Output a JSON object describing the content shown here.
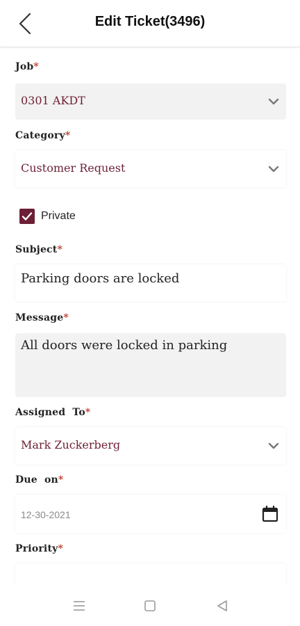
{
  "header": {
    "title": "Edit Ticket(3496)"
  },
  "form": {
    "job": {
      "label": "Job",
      "value": "0301 AKDT"
    },
    "category": {
      "label": "Category",
      "value": "Customer Request"
    },
    "private": {
      "label": "Private",
      "checked": true
    },
    "subject": {
      "label": "Subject",
      "value": "Parking doors are locked"
    },
    "message": {
      "label": "Message",
      "value": "All doors were locked in parking"
    },
    "assigned_to": {
      "label": "Assigned  To",
      "value": "Mark Zuckerberg"
    },
    "due_on": {
      "label": "Due  on",
      "value": "12-30-2021"
    },
    "priority": {
      "label": "Priority"
    },
    "required_marker": "*"
  },
  "colors": {
    "accent": "#6d1f35",
    "required": "#c0392b",
    "field_bg": "#f2f2f2"
  },
  "icons": {
    "back": "chevron-left-icon",
    "dropdown": "chevron-down-icon",
    "calendar": "calendar-icon",
    "nav_menu": "menu-icon",
    "nav_home": "square-icon",
    "nav_back": "triangle-left-icon"
  }
}
